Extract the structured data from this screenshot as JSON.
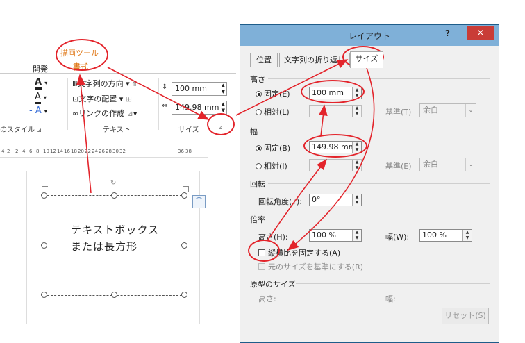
{
  "ribbon": {
    "tool_tab_label": "描画ツール",
    "dev_tab": "開発",
    "format_tab": "書式",
    "text_direction": "文字列の方向",
    "text_align": "文字の配置",
    "create_link": "リンクの作成",
    "group_styles": "のスタイル",
    "group_text": "テキスト",
    "group_size": "サイズ",
    "height_value": "100 mm",
    "width_value": "149.98 mm"
  },
  "ruler": [
    "4",
    "2",
    "2",
    "4",
    "6",
    "8",
    "10",
    "12",
    "14",
    "16",
    "18",
    "20",
    "22",
    "24",
    "26",
    "28",
    "30",
    "32",
    "36",
    "38"
  ],
  "textbox": {
    "line1": "テキストボックス",
    "line2": "または長方形"
  },
  "dialog": {
    "title": "レイアウト",
    "help": "?",
    "close": "×",
    "tabs": [
      "位置",
      "文字列の折り返し",
      "サイズ"
    ],
    "height_section": "高さ",
    "fixed_h": "固定(E)",
    "fixed_h_value": "100 mm",
    "relative_h": "相対(L)",
    "base_t": "基準(T)",
    "base_t_value": "余白",
    "width_section": "幅",
    "fixed_w": "固定(B)",
    "fixed_w_value": "149.98 mm",
    "relative_w": "相対(I)",
    "base_e": "基準(E)",
    "base_e_value": "余白",
    "rotation_section": "回転",
    "rotation_label": "回転角度(T):",
    "rotation_value": "0°",
    "scale_section": "倍率",
    "scale_h_label": "高さ(H):",
    "scale_h_value": "100 %",
    "scale_w_label": "幅(W):",
    "scale_w_value": "100 %",
    "lock_aspect": "縦横比を固定する(A)",
    "relative_original": "元のサイズを基準にする(R)",
    "original_section": "原型のサイズ",
    "orig_h": "高さ:",
    "orig_w": "幅:",
    "reset": "リセット(S)"
  },
  "colors": {
    "accent_red": "#e3242b",
    "tool_orange": "#e07c1f",
    "title_blue": "#7fb0d8"
  }
}
